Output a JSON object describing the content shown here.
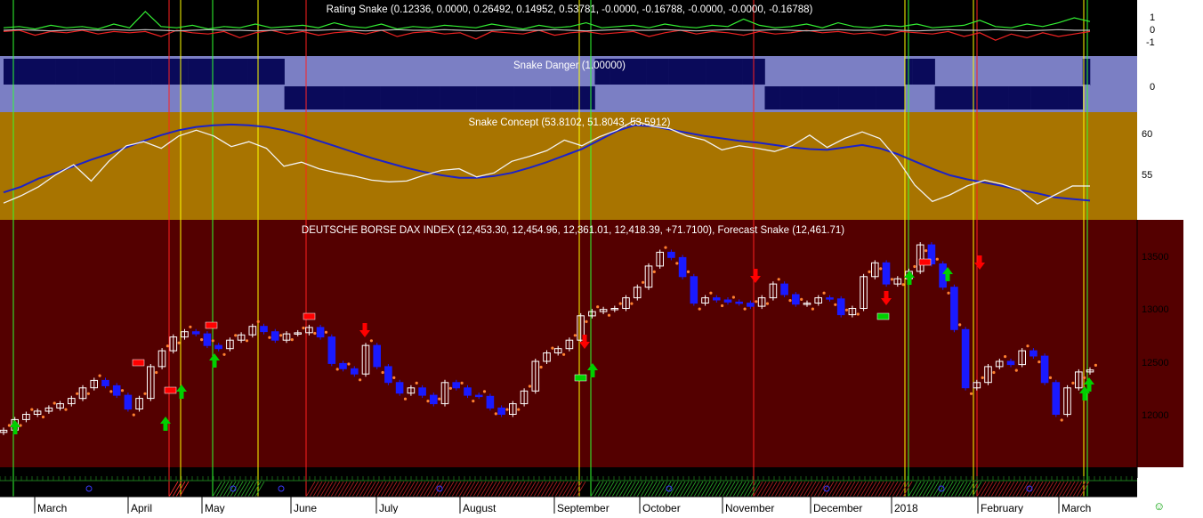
{
  "colors": {
    "rating_bg": "#000000",
    "danger_bg": "#7b7fc4",
    "danger_bar": "#0a0a5a",
    "concept_bg": "#a87400",
    "dax_bg": "#540000",
    "concept_slow": "#1c22c8",
    "concept_fast": "#f2f2f2",
    "candle_up": "#ffffff",
    "candle_down": "#1a1aff",
    "forecast_dot": "#ff8030",
    "buy_arrow": "#00d000",
    "sell_arrow": "#ff0000",
    "vline_red": "#ff2020",
    "vline_green": "#30ff30",
    "vline_yellow": "#ffff00"
  },
  "panels": {
    "rating": {
      "label": "Rating Snake (0.12336, 0.0000, 0.26492, 0.14952, 0.53781, -0.0000, -0.16788, -0.0000, -0.0000, -0.16788)",
      "ticks": [
        "1",
        "0",
        "-1"
      ]
    },
    "danger": {
      "label": "Snake Danger (1.00000)",
      "ticks": [
        "0"
      ]
    },
    "concept": {
      "label": "Snake Concept (53.8102, 51.8043, 53.5912)",
      "ticks": [
        "60",
        "55"
      ]
    },
    "dax": {
      "label": "DEUTSCHE BORSE DAX INDEX (12,453.30, 12,454.96, 12,361.01, 12,418.39, +71.7100), Forecast Snake (12,461.71)",
      "ticks": [
        "13500",
        "13000",
        "12500",
        "12000"
      ]
    }
  },
  "x_axis": {
    "months": [
      "March",
      "April",
      "May",
      "June",
      "July",
      "August",
      "September",
      "October",
      "November",
      "December",
      "2018",
      "February",
      "March"
    ]
  },
  "smiley": "☺",
  "chart_data": [
    {
      "type": "line",
      "title": "Rating Snake (0.12336, 0.0000, 0.26492, 0.14952, 0.53781, -0.0000, -0.16788, -0.0000, -0.0000, -0.16788)",
      "ylim": [
        -1.5,
        1.5
      ],
      "series": [
        {
          "values": [
            0.2,
            0.3,
            0.1,
            0.4,
            0.2,
            0.3,
            0.1,
            0.5,
            0.2,
            1.5,
            0.3,
            0.2,
            0.4,
            0.1,
            0.3,
            0.2,
            0.5,
            0.2,
            0.3,
            0.4,
            0.2,
            0.6,
            0.3,
            0.2,
            0.5,
            0.1,
            0.3,
            0.2,
            0.4,
            0.3,
            0.2,
            0.5,
            0.3,
            0.1,
            0.4,
            0.2,
            0.3,
            0.6,
            0.2,
            0.3,
            0.4,
            0.2,
            0.5,
            0.3,
            0.2,
            0.4,
            0.3,
            0.9,
            0.4,
            0.2,
            0.3,
            0.5,
            0.2,
            0.6,
            0.3,
            0.2,
            0.4,
            0.3,
            0.5,
            0.2,
            0.3,
            0.4,
            0.8,
            0.3,
            0.2,
            0.5,
            0.3,
            0.6,
            1.0,
            0.7
          ]
        },
        {
          "values": [
            -0.1,
            0.0,
            -0.4,
            -0.1,
            -0.2,
            0.0,
            -0.3,
            -0.1,
            -0.2,
            -0.1,
            -0.5,
            0.0,
            -0.2,
            -0.3,
            -0.1,
            -0.6,
            -0.2,
            0.0,
            -0.3,
            -0.1,
            -0.4,
            -0.2,
            -0.1,
            -0.3,
            0.0,
            -0.5,
            -0.2,
            -0.1,
            -0.3,
            -0.2,
            -0.7,
            -0.1,
            -0.2,
            -0.3,
            0.0,
            -0.4,
            -0.2,
            -0.1,
            -0.3,
            -0.2,
            -0.1,
            -0.5,
            -0.2,
            0.0,
            -0.3,
            -0.1,
            -0.2,
            -0.4,
            -0.1,
            -0.3,
            -0.2,
            0.0,
            -0.2,
            -0.1,
            -0.3,
            -0.2,
            -0.4,
            -0.1,
            -0.2,
            -0.3,
            -0.1,
            -0.5,
            -0.2,
            -0.8,
            -0.3,
            -0.6,
            -0.2,
            -0.5,
            -0.3,
            -0.1
          ]
        },
        {
          "values": [
            0.0,
            0.05,
            0.0,
            -0.05,
            0.0,
            0.05,
            0.0,
            0.05,
            0.0,
            0.05,
            0.0,
            -0.05,
            0.0,
            0.05,
            0.0,
            0.0,
            -0.05,
            0.0,
            0.05,
            0.0,
            0.0,
            0.05,
            0.0,
            -0.05,
            0.0,
            0.05,
            0.0,
            0.0,
            0.05,
            0.0,
            -0.05,
            0.0,
            0.05,
            0.0,
            0.0,
            0.05,
            0.0,
            -0.05,
            0.0,
            0.05,
            0.0,
            0.0,
            0.05,
            0.0,
            -0.05,
            0.0,
            0.05,
            0.0,
            0.0,
            0.05,
            0.0,
            -0.05,
            0.0,
            0.05,
            0.0,
            0.0,
            0.05,
            0.0,
            -0.05,
            0.0,
            0.05,
            0.0,
            0.0,
            0.05,
            0.0,
            -0.05,
            0.0,
            0.05,
            0.0,
            0.0
          ]
        }
      ]
    },
    {
      "type": "bar",
      "title": "Snake Danger (1.00000)",
      "values": [
        1,
        1,
        1,
        1,
        1,
        1,
        1,
        1,
        1,
        1,
        1,
        1,
        1,
        1,
        1,
        1,
        1,
        1,
        1,
        1,
        1,
        1,
        1,
        1,
        1,
        1,
        1,
        1,
        1,
        1,
        1,
        1,
        1,
        1,
        1,
        1,
        1,
        1,
        -1,
        -1,
        -1,
        -1,
        -1,
        -1,
        -1,
        -1,
        -1,
        -1,
        -1,
        -1,
        -1,
        -1,
        -1,
        -1,
        -1,
        -1,
        -1,
        -1,
        -1,
        -1,
        -1,
        -1,
        -1,
        -1,
        -1,
        -1,
        -1,
        -1,
        -1,
        -1,
        -1,
        -1,
        -1,
        -1,
        -1,
        -1,
        -1,
        -1,
        -1,
        -1,
        1,
        1,
        1,
        1,
        1,
        1,
        1,
        1,
        1,
        1,
        1,
        1,
        1,
        1,
        1,
        1,
        1,
        1,
        1,
        1,
        1,
        1,
        1,
        -1,
        -1,
        -1,
        -1,
        -1,
        -1,
        -1,
        -1,
        -1,
        -1,
        -1,
        -1,
        -1,
        -1,
        -1,
        -1,
        -1,
        -1,
        -1,
        1,
        1,
        1,
        1,
        -1,
        -1,
        -1,
        -1,
        -1,
        -1,
        -1,
        -1,
        -1,
        -1,
        -1,
        -1,
        -1,
        -1,
        -1,
        -1,
        -1,
        -1,
        -1,
        -1,
        1
      ],
      "ylim": [
        -1,
        1
      ]
    },
    {
      "type": "line",
      "title": "Snake Concept (53.8102, 51.8043, 53.5912)",
      "ylim": [
        50.5,
        62.5
      ],
      "series": [
        {
          "values": [
            52.8,
            53.5,
            54.5,
            55.2,
            56.0,
            56.8,
            57.5,
            58.3,
            59.1,
            59.8,
            60.4,
            60.8,
            61.0,
            61.1,
            61.0,
            60.8,
            60.4,
            59.8,
            59.1,
            58.4,
            57.7,
            57.0,
            56.4,
            55.8,
            55.3,
            54.9,
            54.6,
            54.6,
            54.8,
            55.2,
            55.8,
            56.5,
            57.3,
            58.1,
            59.2,
            60.3,
            61.0,
            60.9,
            60.5,
            60.1,
            59.7,
            59.4,
            59.1,
            58.9,
            58.6,
            58.3,
            58.1,
            58.0,
            58.3,
            58.6,
            58.2,
            57.5,
            56.6,
            55.7,
            54.9,
            54.4,
            54.0,
            53.6,
            53.1,
            52.7,
            52.2,
            52.0,
            51.8
          ]
        },
        {
          "values": [
            51.5,
            52.4,
            53.5,
            55.0,
            56.2,
            54.2,
            56.6,
            58.5,
            59.0,
            58.2,
            59.7,
            60.4,
            59.7,
            58.4,
            59.0,
            58.2,
            56.0,
            56.5,
            55.7,
            55.2,
            54.8,
            54.3,
            54.1,
            54.2,
            54.9,
            55.5,
            55.7,
            54.7,
            55.2,
            56.6,
            57.2,
            57.9,
            59.2,
            58.5,
            59.6,
            60.4,
            61.6,
            60.9,
            60.6,
            59.7,
            59.2,
            58.0,
            58.5,
            58.2,
            57.8,
            58.5,
            59.8,
            58.3,
            59.4,
            60.2,
            59.4,
            56.9,
            53.7,
            51.7,
            52.5,
            53.6,
            54.3,
            53.8,
            53.1,
            51.4,
            52.5,
            53.6,
            53.59
          ]
        }
      ]
    },
    {
      "type": "line",
      "title": "DEUTSCHE BORSE DAX INDEX (12,453.30, 12,454.96, 12,361.01, 12,418.39, +71.7100), Forecast Snake (12,461.71)",
      "ylim": [
        11500,
        13700
      ],
      "series": [
        {
          "values": [
            11850,
            11950,
            12000,
            12030,
            12060,
            12100,
            12150,
            12250,
            12320,
            12270,
            12180,
            12050,
            12150,
            12450,
            12600,
            12730,
            12780,
            12760,
            12650,
            12620,
            12700,
            12750,
            12830,
            12780,
            12700,
            12760,
            12770,
            12820,
            12730,
            12480,
            12430,
            12380,
            12650,
            12450,
            12300,
            12200,
            12250,
            12180,
            12100,
            12300,
            12250,
            12180,
            12170,
            12060,
            12000,
            12100,
            12220,
            12500,
            12580,
            12620,
            12700,
            12930,
            12970,
            12990,
            13000,
            13100,
            13200,
            13400,
            13530,
            13480,
            13300,
            13050,
            13100,
            13080,
            13060,
            13050,
            13020,
            13100,
            13230,
            13130,
            13040,
            13050,
            13100,
            13090,
            12940,
            13000,
            13300,
            13430,
            13230,
            13280,
            13350,
            13600,
            13420,
            13200,
            12800,
            12250,
            12300,
            12450,
            12500,
            12470,
            12600,
            12550,
            12300,
            12000,
            12250,
            12400,
            12418.39
          ]
        }
      ]
    }
  ]
}
